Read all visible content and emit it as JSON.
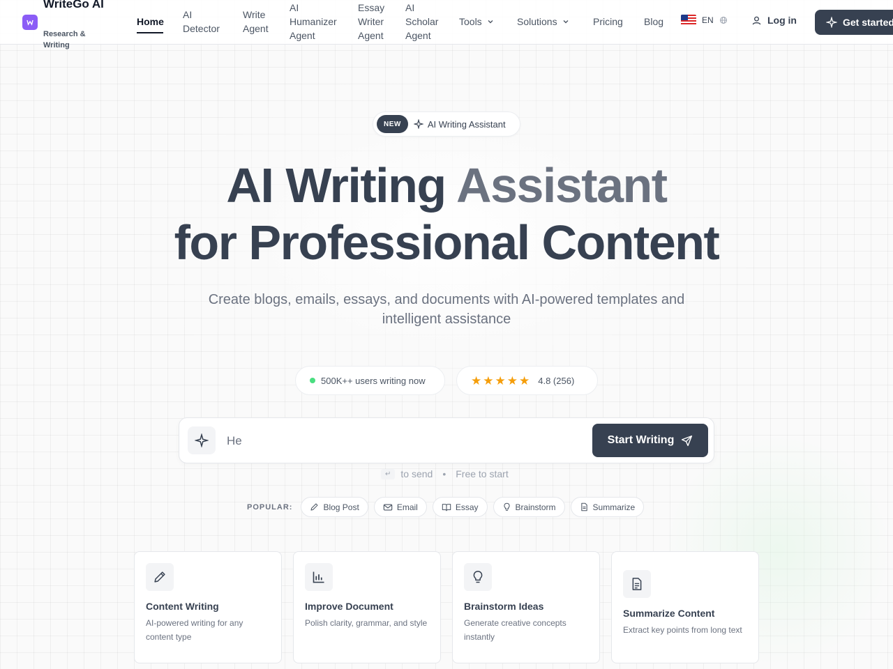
{
  "brand": {
    "name": "WriteGo AI",
    "tagline": "Research & Writing"
  },
  "nav": {
    "links": [
      {
        "label": "Home"
      },
      {
        "label": "AI Detector"
      },
      {
        "label": "Write Agent"
      },
      {
        "label": "AI Humanizer Agent"
      },
      {
        "label": "Essay Writer Agent"
      },
      {
        "label": "AI Scholar Agent"
      },
      {
        "label": "Tools"
      },
      {
        "label": "Solutions"
      },
      {
        "label": "Pricing"
      },
      {
        "label": "Blog"
      }
    ],
    "language": "EN",
    "login": "Log in",
    "cta": "Get started"
  },
  "hero": {
    "badge": "NEW",
    "pill_text": "AI Writing Assistant",
    "title_part1": "AI Writing",
    "title_part2": "Assistant",
    "title_line2": "for Professional Content",
    "subtitle": "Create blogs, emails, essays, and documents with AI-powered templates and intelligent assistance"
  },
  "stats": {
    "users": "500K++ users writing now",
    "rating": "4.8 (256)",
    "stars": 5
  },
  "prompt": {
    "value": "He",
    "button": "Start Writing",
    "enter_key": "↵",
    "hint_send": "to send",
    "hint_free": "Free to start"
  },
  "popular": {
    "label": "POPULAR:",
    "chips": [
      "Blog Post",
      "Email",
      "Essay",
      "Brainstorm",
      "Summarize"
    ]
  },
  "cards": [
    {
      "title": "Content Writing",
      "desc": "AI-powered writing for any content type"
    },
    {
      "title": "Improve Document",
      "desc": "Polish clarity, grammar, and style"
    },
    {
      "title": "Brainstorm Ideas",
      "desc": "Generate creative concepts instantly"
    },
    {
      "title": "Summarize Content",
      "desc": "Extract key points from long text"
    }
  ],
  "colors": {
    "accent": "#374151",
    "logo": "#8b5cf6",
    "star": "#f59e0b",
    "online": "#4ade80"
  }
}
